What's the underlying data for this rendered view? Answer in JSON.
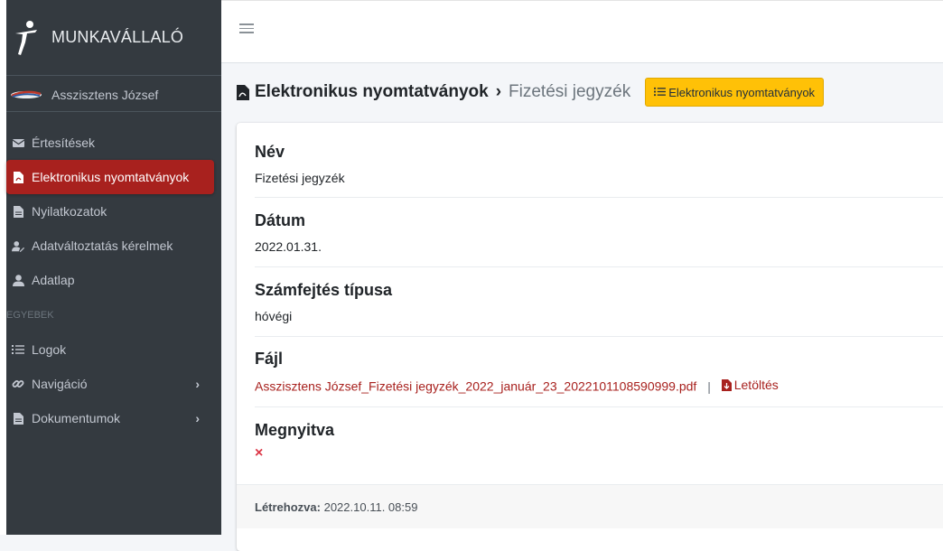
{
  "brand": {
    "name": "MUNKAVÁLLALÓ",
    "logo_icon": "running-figure-icon"
  },
  "user": {
    "name": "Asszisztens József",
    "avatar_icon": "company-logo-avatar"
  },
  "sidebar": {
    "items": [
      {
        "label": "Értesítések",
        "icon": "envelope-icon"
      },
      {
        "label": "Elektronikus nyomtatványok",
        "icon": "file-pdf-icon",
        "active": true
      },
      {
        "label": "Nyilatkozatok",
        "icon": "file-icon"
      },
      {
        "label": "Adatváltoztatás kérelmek",
        "icon": "user-edit-icon"
      },
      {
        "label": "Adatlap",
        "icon": "user-icon"
      }
    ],
    "section_header": "EGYEBEK",
    "other_items": [
      {
        "label": "Logok",
        "icon": "list-icon"
      },
      {
        "label": "Navigáció",
        "icon": "link-icon",
        "has_submenu": true
      },
      {
        "label": "Dokumentumok",
        "icon": "file-icon",
        "has_submenu": true
      }
    ]
  },
  "header": {
    "title": "Elektronikus nyomtatványok",
    "separator": "›",
    "current": "Fizetési jegyzék",
    "button_label": "Elektronikus nyomtatványok"
  },
  "details": {
    "name_label": "Név",
    "name_value": "Fizetési jegyzék",
    "date_label": "Dátum",
    "date_value": "2022.01.31.",
    "type_label": "Számfejtés típusa",
    "type_value": "hóvégi",
    "file_label": "Fájl",
    "file_name": "Asszisztens József_Fizetési jegyzék_2022_január_23_2022101108590999.pdf",
    "file_separator": "|",
    "download_label": "Letöltés",
    "opened_label": "Megnyitva",
    "opened_value": "×"
  },
  "footer": {
    "created_label": "Létrehozva:",
    "created_value": "2022.10.11. 08:59"
  },
  "colors": {
    "sidebar_bg": "#343a40",
    "active_bg": "#a8211e",
    "warning": "#ffc107",
    "link": "#a8211e",
    "danger": "#dc3545"
  }
}
